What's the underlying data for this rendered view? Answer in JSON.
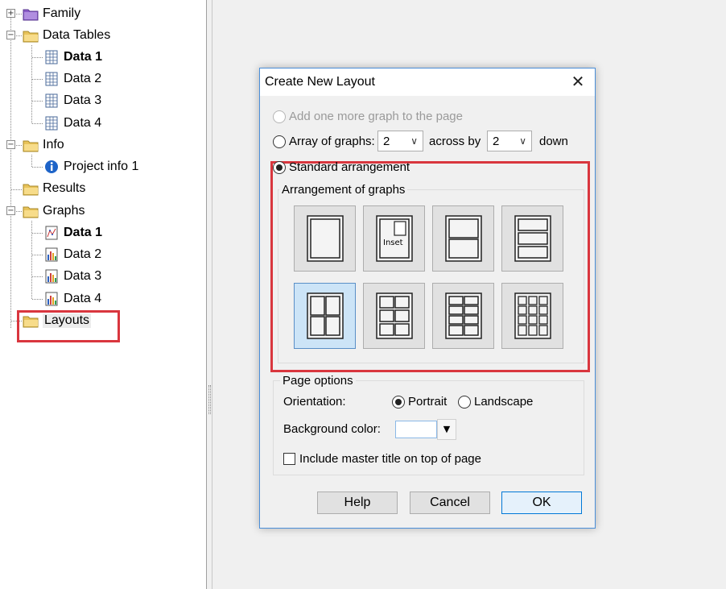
{
  "tree": {
    "items": [
      {
        "label": "Family",
        "icon": "family-folder-icon",
        "bold": false
      },
      {
        "label": "Data Tables",
        "icon": "folder-icon",
        "bold": false
      },
      {
        "label": "Data 1",
        "icon": "data-table-icon",
        "bold": true
      },
      {
        "label": "Data 2",
        "icon": "data-table-icon",
        "bold": false
      },
      {
        "label": "Data 3",
        "icon": "data-table-icon",
        "bold": false
      },
      {
        "label": "Data 4",
        "icon": "data-table-icon",
        "bold": false
      },
      {
        "label": "Info",
        "icon": "folder-icon",
        "bold": false
      },
      {
        "label": "Project info 1",
        "icon": "info-icon",
        "bold": false
      },
      {
        "label": "Results",
        "icon": "folder-icon",
        "bold": false
      },
      {
        "label": "Graphs",
        "icon": "folder-icon",
        "bold": false
      },
      {
        "label": "Data 1",
        "icon": "graph-icon",
        "bold": true
      },
      {
        "label": "Data 2",
        "icon": "bar-graph-icon",
        "bold": false
      },
      {
        "label": "Data 3",
        "icon": "bar-graph-icon",
        "bold": false
      },
      {
        "label": "Data 4",
        "icon": "bar-graph-icon",
        "bold": false
      },
      {
        "label": "Layouts",
        "icon": "folder-icon",
        "bold": false
      }
    ],
    "expander_plus": "+",
    "expander_minus": "−"
  },
  "dialog": {
    "title": "Create New Layout",
    "close_glyph": "✕",
    "add_graph_label": "Add one more graph to the page",
    "array_label": "Array of graphs:",
    "across_value": "2",
    "across_label": "across by",
    "down_value": "2",
    "down_label": "down",
    "combo_arrow": "∨",
    "standard_label": "Standard arrangement",
    "arrangement_title": "Arrangement of graphs",
    "inset_label": "Inset",
    "page_options_title": "Page options",
    "orientation_label": "Orientation:",
    "portrait_label": "Portrait",
    "landscape_label": "Landscape",
    "background_label": "Background color:",
    "background_value": "#ffffff",
    "dropdown_glyph": "▼",
    "master_title_label": "Include master title on top of page",
    "help_label": "Help",
    "cancel_label": "Cancel",
    "ok_label": "OK"
  },
  "colors": {
    "highlight": "#d9363e",
    "selection": "#cce4f7",
    "dialog_border": "#4a8ed8"
  }
}
